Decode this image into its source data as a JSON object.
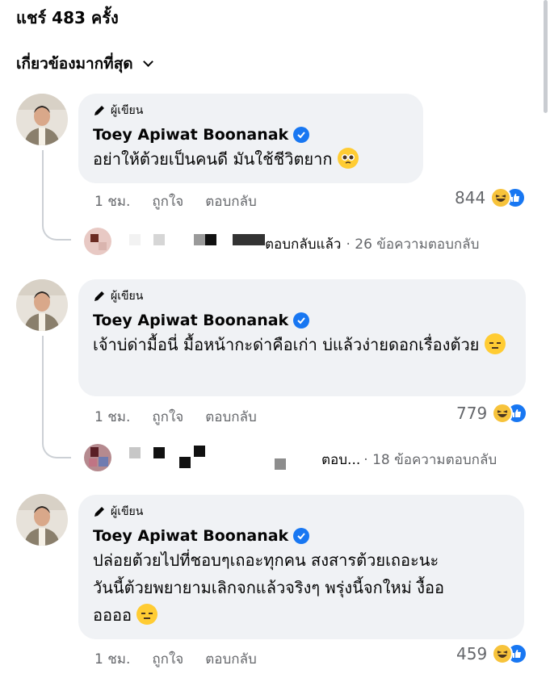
{
  "header": {
    "share_count": "แชร์ 483 ครั้ง",
    "sort_label": "เกี่ยวข้องมากที่สุด"
  },
  "comments": [
    {
      "badge": "ผู้เขียน",
      "author": "Toey Apiwat Boonanak",
      "text": "อย่าให้ต้วยเป็นคนดี มันใช้ชีวิตยาก",
      "emoji": "pleading-face",
      "time": "1 ชม.",
      "like": "ถูกใจ",
      "reply": "ตอบกลับ",
      "reaction_count": "844",
      "reply_summary_action": "ตอบกลับแล้ว",
      "reply_summary_count": "· 26 ข้อความตอบกลับ"
    },
    {
      "badge": "ผู้เขียน",
      "author": "Toey Apiwat Boonanak",
      "text": "เจ้าบ่ด่ามื้อนี่ มื้อหน้ากะด่าคือเก่า บ่แล้วง่ายดอกเรื่องต้วย",
      "emoji": "expressionless-face",
      "time": "1 ชม.",
      "like": "ถูกใจ",
      "reply": "ตอบกลับ",
      "reaction_count": "779",
      "reply_summary_action": "ตอบ...",
      "reply_summary_count": "· 18 ข้อความตอบกลับ"
    },
    {
      "badge": "ผู้เขียน",
      "author": "Toey Apiwat Boonanak",
      "text_line1": "ปล่อยต้วยไปที่ชอบๆเถอะทุกคน สงสารต้วยเถอะนะ",
      "text_line2": "วันนี้ต้วยพยายามเลิกจกแล้วจริงๆ พรุ่งนี้จกใหม่ งื้ออ",
      "text_line3": "ออออ",
      "emoji": "expressionless-face",
      "time": "1 ชม.",
      "like": "ถูกใจ",
      "reply": "ตอบกลับ",
      "reaction_count": "459"
    }
  ],
  "colors": {
    "bubble": "#f0f2f5",
    "meta": "#65676b",
    "verified": "#1877f2",
    "haha": "#f7c33b"
  }
}
